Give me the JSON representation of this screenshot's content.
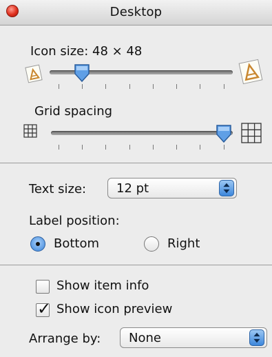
{
  "window": {
    "title": "Desktop"
  },
  "icon_size": {
    "label": "Icon size: 48 × 48",
    "slider_fraction": 0.14
  },
  "grid_spacing": {
    "label": "Grid spacing",
    "slider_fraction": 1.0
  },
  "text_size": {
    "label": "Text size:",
    "value": "12 pt"
  },
  "label_position": {
    "label": "Label position:",
    "options": [
      {
        "label": "Bottom",
        "selected": true
      },
      {
        "label": "Right",
        "selected": false
      }
    ]
  },
  "checkboxes": [
    {
      "label": "Show item info",
      "checked": false
    },
    {
      "label": "Show icon preview",
      "checked": true
    }
  ],
  "arrange_by": {
    "label": "Arrange by:",
    "value": "None"
  }
}
